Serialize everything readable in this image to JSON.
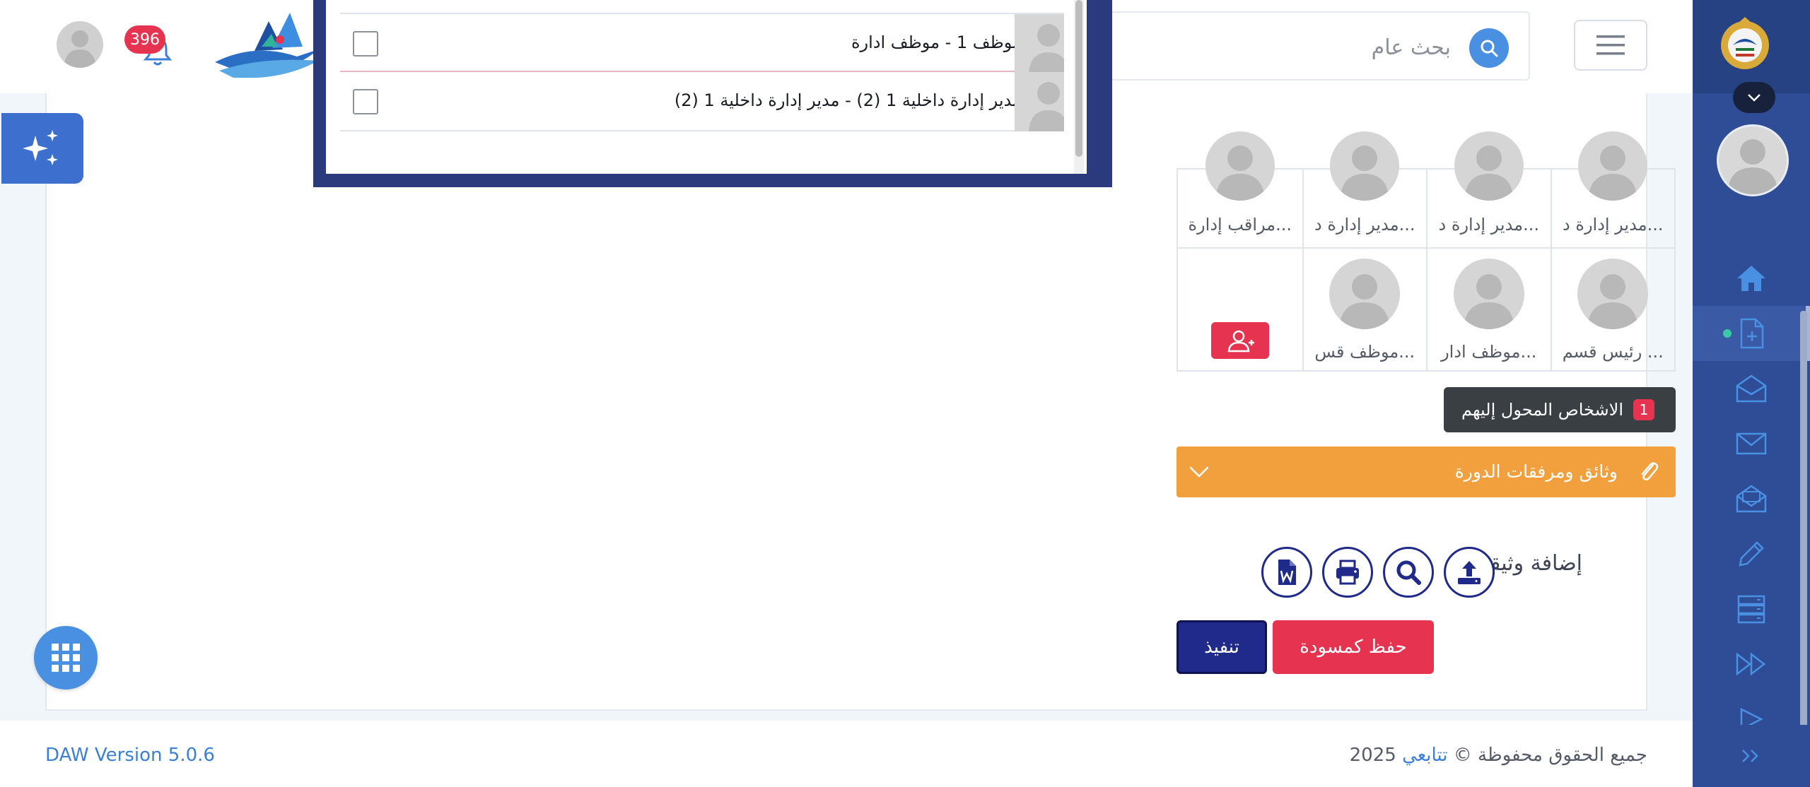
{
  "header": {
    "search_placeholder": "بحث عام",
    "notification_count": "396"
  },
  "popup": {
    "options": [
      {
        "label": "موظف 1 - موظف ادارة"
      },
      {
        "label": "مدير إدارة داخلية 1 (2) - مدير إدارة داخلية 1 (2)"
      }
    ]
  },
  "people": {
    "row1": [
      "مدير إدارة د...",
      "مدير إدارة د...",
      "مدير إدارة د...",
      "مراقب إدارة..."
    ],
    "row2": [
      "رئيس قسم ...",
      "موظف ادار...",
      "موظف قس..."
    ]
  },
  "transferred": {
    "label": "الاشخاص المحول إليهم",
    "count": "1"
  },
  "attachments": {
    "title": "وثائق ومرفقات الدورة"
  },
  "documents": {
    "add_label": "إضافة وثيقة"
  },
  "actions": {
    "execute": "تنفيذ",
    "save_draft": "حفظ كمسودة"
  },
  "footer": {
    "version": "DAW Version 5.0.6",
    "copyright_prefix": "جميع الحقوق محفوظة ©",
    "brand": "تتابعي",
    "year": "2025"
  },
  "colors": {
    "sidebar": "#2f4d97",
    "accent_blue": "#4a90e2",
    "danger": "#e53350",
    "orange": "#f29f3d",
    "navy": "#1f2a8a"
  }
}
